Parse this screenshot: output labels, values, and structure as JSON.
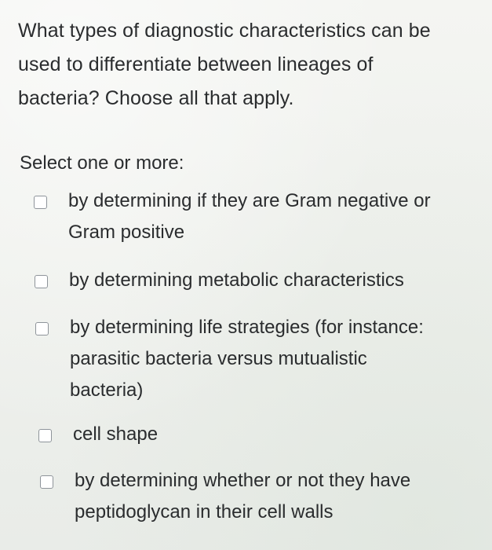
{
  "question": {
    "text": "What types of diagnostic characteristics can be\nused to differentiate between lineages of\nbacteria? Choose all that apply."
  },
  "prompt": {
    "text": "Select one or more:"
  },
  "options": [
    {
      "label": "by determining if they are Gram negative or\nGram positive",
      "checked": false
    },
    {
      "label": "by determining metabolic characteristics",
      "checked": false
    },
    {
      "label": "by determining life strategies (for instance:\nparasitic bacteria versus mutualistic\nbacteria)",
      "checked": false
    },
    {
      "label": "cell shape",
      "checked": false
    },
    {
      "label": "by determining whether or not they have\npeptidoglycan in their cell walls",
      "checked": false
    }
  ]
}
